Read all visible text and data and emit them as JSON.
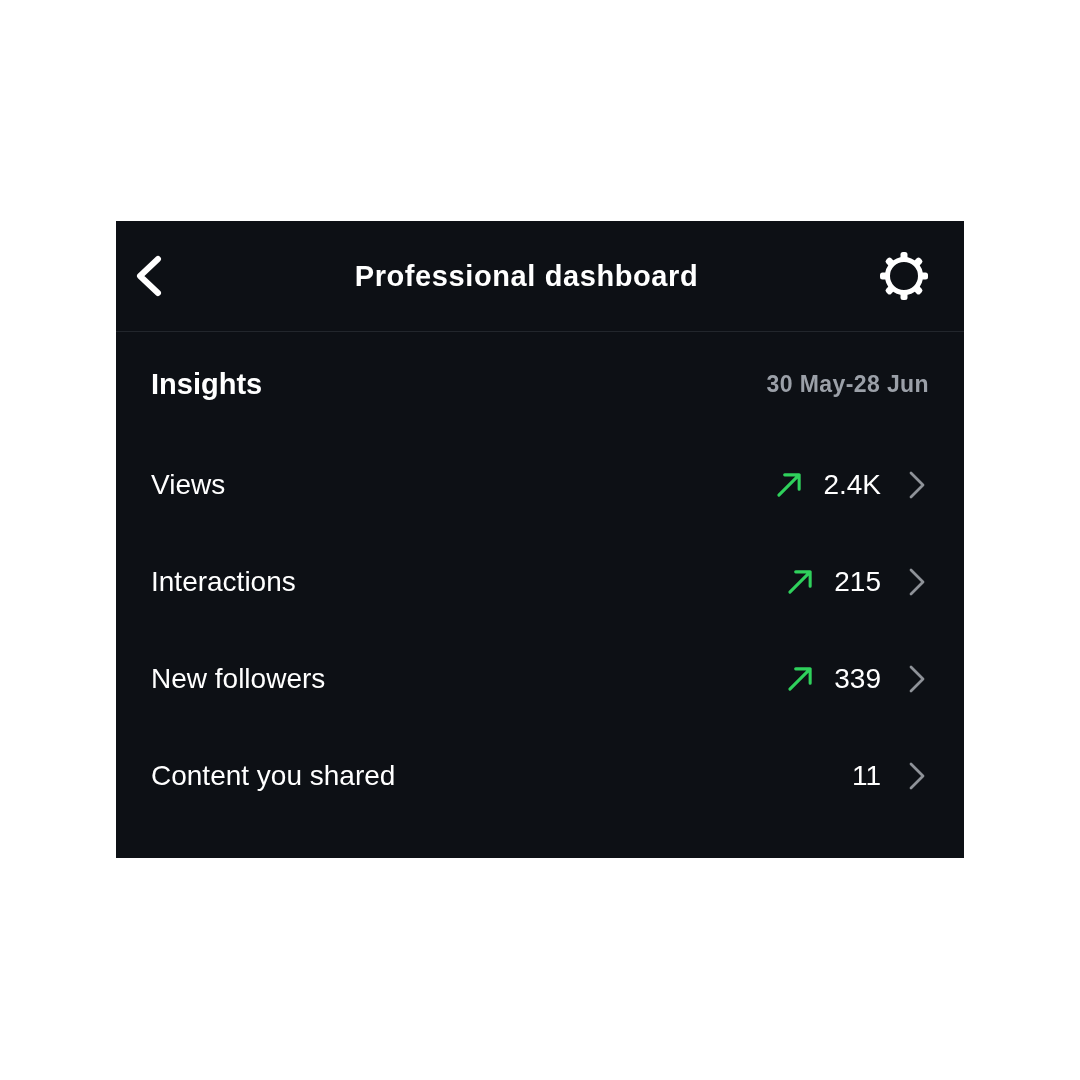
{
  "header": {
    "title": "Professional dashboard"
  },
  "insights": {
    "title": "Insights",
    "date_range": "30 May-28 Jun"
  },
  "rows": [
    {
      "label": "Views",
      "rising": true,
      "value": "2.4K"
    },
    {
      "label": "Interactions",
      "rising": true,
      "value": "215"
    },
    {
      "label": "New followers",
      "rising": true,
      "value": "339"
    },
    {
      "label": "Content you shared",
      "rising": false,
      "value": "11"
    }
  ]
}
